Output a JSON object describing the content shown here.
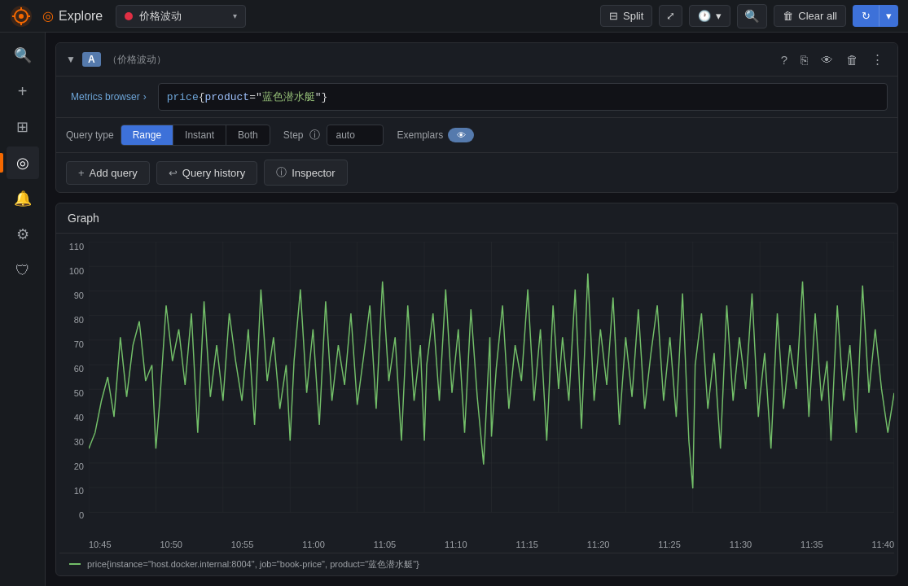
{
  "topbar": {
    "logo_alt": "Grafana",
    "explore_label": "Explore",
    "datasource_name": "价格波动",
    "split_label": "Split",
    "share_icon": "share",
    "time_icon": "clock",
    "zoom_icon": "zoom-out",
    "clear_label": "Clear all",
    "run_label": "Run query",
    "chevron_down": "▾"
  },
  "sidebar": {
    "items": [
      {
        "icon": "🔍",
        "name": "search"
      },
      {
        "icon": "＋",
        "name": "add"
      },
      {
        "icon": "⊞",
        "name": "dashboards"
      },
      {
        "icon": "◎",
        "name": "explore",
        "active": true
      },
      {
        "icon": "🔔",
        "name": "alerts"
      },
      {
        "icon": "⚙",
        "name": "settings"
      },
      {
        "icon": "🛡",
        "name": "security"
      }
    ]
  },
  "query": {
    "label": "A",
    "datasource_display": "（价格波动）",
    "metrics_browser_label": "Metrics browser",
    "metrics_browser_chevron": "›",
    "query_text": "price{product=\"蓝色潜水艇\"}",
    "query_type_label": "Query type",
    "query_types": [
      "Range",
      "Instant",
      "Both",
      "Step"
    ],
    "active_query_type": "Range",
    "step_placeholder": "auto",
    "exemplars_label": "Exemplars",
    "add_query_label": "Add query",
    "query_history_label": "Query history",
    "inspector_label": "Inspector"
  },
  "graph": {
    "title": "Graph",
    "y_axis": [
      "110",
      "100",
      "90",
      "80",
      "70",
      "60",
      "50",
      "40",
      "30",
      "20",
      "10",
      "0"
    ],
    "x_axis": [
      "10:45",
      "10:50",
      "10:55",
      "11:00",
      "11:05",
      "11:10",
      "11:15",
      "11:20",
      "11:25",
      "11:30",
      "11:35",
      "11:40"
    ],
    "legend_text": "price{instance=\"host.docker.internal:8004\", job=\"book-price\", product=\"蓝色潜水艇\"}"
  }
}
